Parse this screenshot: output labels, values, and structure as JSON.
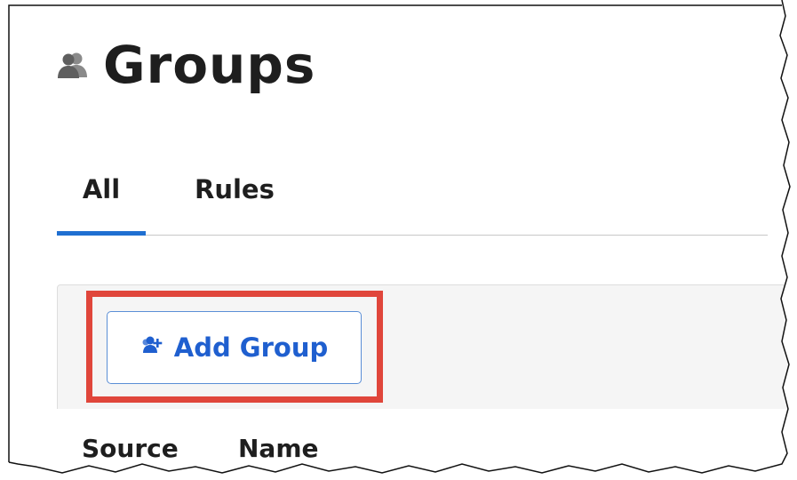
{
  "header": {
    "title": "Groups",
    "icon": "group-icon"
  },
  "tabs": [
    {
      "label": "All",
      "active": true
    },
    {
      "label": "Rules",
      "active": false
    }
  ],
  "toolbar": {
    "add_group_label": "Add Group",
    "add_group_icon": "add-user-icon"
  },
  "table": {
    "columns": [
      "Source",
      "Name"
    ]
  },
  "colors": {
    "accent": "#1f6fd1",
    "button_text": "#1f5fcf",
    "highlight": "#e0463b",
    "title": "#1e1e1e"
  }
}
